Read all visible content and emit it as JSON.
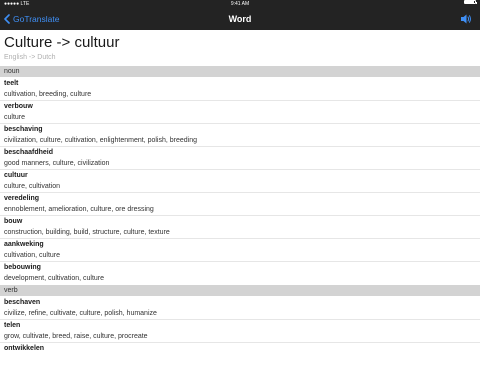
{
  "status_bar": {
    "carrier": "●●●●● LTE",
    "time": "9:41 AM",
    "battery_level": 0.9
  },
  "nav": {
    "back_label": "GoTranslate",
    "title": "Word"
  },
  "header": {
    "title": "Culture -> cultuur",
    "subtitle": "English -> Dutch"
  },
  "sections": [
    {
      "label": "noun",
      "entries": [
        {
          "word": "teelt",
          "meanings": "cultivation, breeding, culture"
        },
        {
          "word": "verbouw",
          "meanings": "culture"
        },
        {
          "word": "beschaving",
          "meanings": "civilization, culture, cultivation, enlightenment, polish, breeding"
        },
        {
          "word": "beschaafdheid",
          "meanings": "good manners, culture, civilization"
        },
        {
          "word": "cultuur",
          "meanings": "culture, cultivation"
        },
        {
          "word": "veredeling",
          "meanings": "ennoblement, amelioration, culture, ore dressing"
        },
        {
          "word": "bouw",
          "meanings": "construction, building, build, structure, culture, texture"
        },
        {
          "word": "aankweking",
          "meanings": "cultivation, culture"
        },
        {
          "word": "bebouwing",
          "meanings": "development, cultivation, culture"
        }
      ]
    },
    {
      "label": "verb",
      "entries": [
        {
          "word": "beschaven",
          "meanings": "civilize, refine, cultivate, culture, polish, humanize"
        },
        {
          "word": "telen",
          "meanings": "grow, cultivate, breed, raise, culture, procreate"
        },
        {
          "word": "ontwikkelen",
          "meanings": ""
        }
      ]
    }
  ],
  "colors": {
    "accent": "#3f8ff5",
    "nav_background": "#232323",
    "section_background": "#d3d3d3"
  }
}
